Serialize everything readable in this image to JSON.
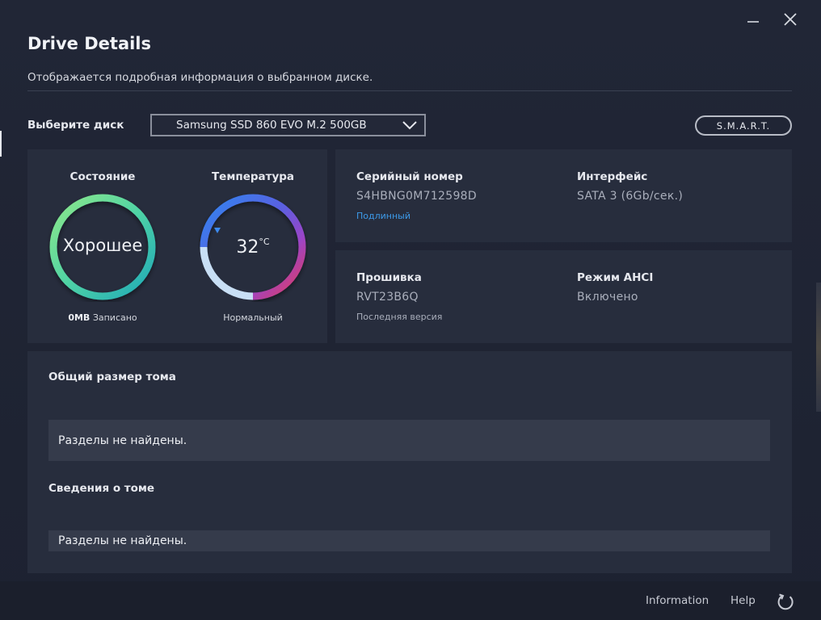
{
  "header": {
    "title": "Drive Details",
    "subtitle": "Отображается подробная информация о выбранном диске."
  },
  "selector": {
    "label": "Выберите диск",
    "selected_drive": "Samsung SSD 860 EVO M.2 500GB",
    "smart_button": "S.M.A.R.T."
  },
  "status": {
    "title": "Состояние",
    "value": "Хорошее",
    "written_amount": "0MB",
    "written_label": "Записано"
  },
  "temperature": {
    "title": "Температура",
    "value": "32",
    "unit": "°C",
    "state": "Нормальный",
    "level": 0.32
  },
  "serial": {
    "label": "Серийный номер",
    "value": "S4HBNG0M712598D",
    "note": "Подлинный"
  },
  "interface": {
    "label": "Интерфейс",
    "value": "SATA 3 (6Gb/сек.)"
  },
  "firmware": {
    "label": "Прошивка",
    "value": "RVT23B6Q",
    "note": "Последняя версия"
  },
  "ahci": {
    "label": "Режим AHCI",
    "value": "Включено"
  },
  "volume": {
    "total_size_label": "Общий размер тома",
    "total_size_message": "Разделы не найдены.",
    "info_label": "Сведения о томе",
    "info_message": "Разделы не найдены."
  },
  "footer": {
    "information": "Information",
    "help": "Help"
  },
  "colors": {
    "background": "#1d2231",
    "panel": "#272d3d",
    "accent_blue": "#3d9bea",
    "gauge_green": "#6fe0a0",
    "gauge_teal": "#2ab8b8",
    "temp_blue": "#3c7ef0",
    "temp_purple": "#8a4fd0",
    "temp_red": "#e63a5a"
  },
  "icons": {
    "minimize": "minimize-icon",
    "close": "close-icon",
    "dropdown": "chevron-down-icon",
    "refresh": "refresh-icon"
  }
}
